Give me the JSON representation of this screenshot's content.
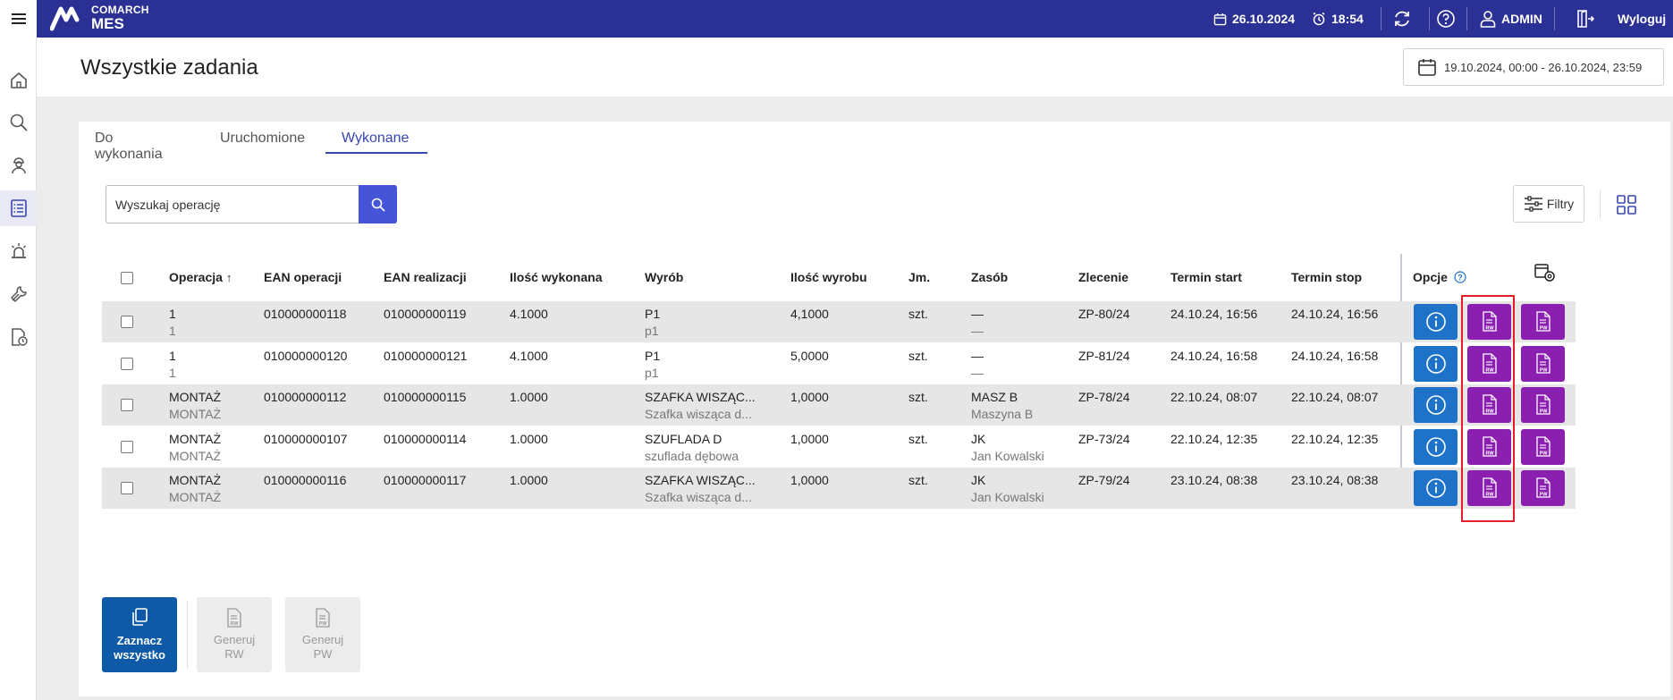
{
  "app": {
    "brand_top": "COMARCH",
    "brand_bottom": "MES"
  },
  "topbar": {
    "date": "26.10.2024",
    "time": "18:54",
    "user": "ADMIN",
    "logout": "Wyloguj"
  },
  "page": {
    "title": "Wszystkie zadania",
    "date_range": "19.10.2024, 00:00 - 26.10.2024, 23:59"
  },
  "tabs": [
    "Do wykonania",
    "Uruchomione",
    "Wykonane"
  ],
  "active_tab": "Wykonane",
  "search": {
    "placeholder": "Wyszukaj operację"
  },
  "toolbar": {
    "filters_label": "Filtry"
  },
  "table": {
    "columns": [
      "Operacja",
      "EAN operacji",
      "EAN realizacji",
      "Ilość wykonana",
      "Wyrób",
      "Ilość wyrobu",
      "Jm.",
      "Zasób",
      "Zlecenie",
      "Termin start",
      "Termin stop",
      "Opcje"
    ],
    "sort_indicator": "↑",
    "rows": [
      {
        "op": "1",
        "op_sub": "1",
        "ean_op": "010000000118",
        "ean_real": "010000000119",
        "qty_done": "4.1000",
        "product": "P1",
        "product_sub": "p1",
        "qty_prod": "4,1000",
        "unit": "szt.",
        "resource": "—",
        "resource_sub": "—",
        "order": "ZP-80/24",
        "start": "24.10.24, 16:56",
        "stop": "24.10.24, 16:56"
      },
      {
        "op": "1",
        "op_sub": "1",
        "ean_op": "010000000120",
        "ean_real": "010000000121",
        "qty_done": "4.1000",
        "product": "P1",
        "product_sub": "p1",
        "qty_prod": "5,0000",
        "unit": "szt.",
        "resource": "—",
        "resource_sub": "—",
        "order": "ZP-81/24",
        "start": "24.10.24, 16:58",
        "stop": "24.10.24, 16:58"
      },
      {
        "op": "MONTAŻ",
        "op_sub": "MONTAŻ",
        "ean_op": "010000000112",
        "ean_real": "010000000115",
        "qty_done": "1.0000",
        "product": "SZAFKA WISZĄC...",
        "product_sub": "Szafka wisząca d...",
        "qty_prod": "1,0000",
        "unit": "szt.",
        "resource": "MASZ B",
        "resource_sub": "Maszyna B",
        "order": "ZP-78/24",
        "start": "22.10.24, 08:07",
        "stop": "22.10.24, 08:07"
      },
      {
        "op": "MONTAŻ",
        "op_sub": "MONTAŻ",
        "ean_op": "010000000107",
        "ean_real": "010000000114",
        "qty_done": "1.0000",
        "product": "SZUFLADA D",
        "product_sub": "szuflada dębowa",
        "qty_prod": "1,0000",
        "unit": "szt.",
        "resource": "JK",
        "resource_sub": "Jan Kowalski",
        "order": "ZP-73/24",
        "start": "22.10.24, 12:35",
        "stop": "22.10.24, 12:35"
      },
      {
        "op": "MONTAŻ",
        "op_sub": "MONTAŻ",
        "ean_op": "010000000116",
        "ean_real": "010000000117",
        "qty_done": "1.0000",
        "product": "SZAFKA WISZĄC...",
        "product_sub": "Szafka wisząca d...",
        "qty_prod": "1,0000",
        "unit": "szt.",
        "resource": "JK",
        "resource_sub": "Jan Kowalski",
        "order": "ZP-79/24",
        "start": "23.10.24, 08:38",
        "stop": "23.10.24, 08:38"
      }
    ]
  },
  "doc_badges": {
    "rw": "RW",
    "pw": "PW"
  },
  "bulk": {
    "select_all_1": "Zaznacz",
    "select_all_2": "wszystko",
    "gen_rw_1": "Generuj",
    "gen_rw_2": "RW",
    "gen_pw_1": "Generuj",
    "gen_pw_2": "PW"
  },
  "colors": {
    "topbar": "#2b3194",
    "info_button": "#1e72c8",
    "doc_button": "#8a1fb0",
    "highlight": "#e41e26",
    "primary": "#0e5aa7"
  }
}
